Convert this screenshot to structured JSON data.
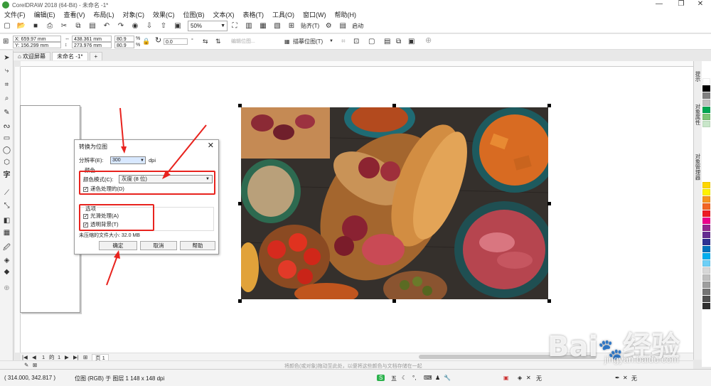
{
  "window": {
    "title": "CorelDRAW 2018 (64-Bit) - 未命名 -1*",
    "minimize": "—",
    "restore": "❐",
    "close": "✕"
  },
  "menu": [
    "文件(F)",
    "编辑(E)",
    "查看(V)",
    "布局(L)",
    "对象(C)",
    "效果(C)",
    "位图(B)",
    "文本(X)",
    "表格(T)",
    "工具(O)",
    "窗口(W)",
    "帮助(H)"
  ],
  "toolbar": {
    "zoom": "50%",
    "snap_label": "贴齐(T)",
    "launch_label": "启动"
  },
  "propbar": {
    "x": "X: 659.97 mm",
    "y": "Y: 156.299 mm",
    "width": "438.361 mm",
    "height": "273.976 mm",
    "scale_x": "80.9",
    "scale_y": "80.9",
    "pct": "%",
    "rotation": "0.0",
    "degree": "°",
    "edit_bitmap": "编辑位图...",
    "trace_bitmap": "描摹位图(T)"
  },
  "tabs": [
    "欢迎屏幕",
    "未命名 -1*"
  ],
  "dialog": {
    "title": "转换为位图",
    "resolution_label": "分辨率(E):",
    "resolution_value": "300",
    "dpi": "dpi",
    "color_section": "颜色",
    "color_mode_label": "颜色模式(C):",
    "color_mode_value": "灰度 (8 位)",
    "dithered_label": "递色处理的(D)",
    "options_section": "选项",
    "antialiasing_label": "光滑处理(A)",
    "transparent_label": "透明背景(T)",
    "uncompressed_size": "未压缩的文件大小: 32.0 MB",
    "ok": "确定",
    "cancel": "取消",
    "help": "帮助"
  },
  "docker_tabs": [
    "提示",
    "对象属性",
    "对象管理器"
  ],
  "page_nav": {
    "page_current": "1",
    "of": "的",
    "page_total": "1",
    "page_tab": "页 1"
  },
  "hint": "将颜色(或对象)拖动至此处，以便将这些颜色与文档存储在一起",
  "status": {
    "coords": "( 314.000, 342.817 )",
    "object_info": "位图 (RGB) 于 图层 1 148 x 148 dpi",
    "fill_none": "无",
    "outline_none": "无",
    "ime": "五"
  },
  "watermark": {
    "brand": "Bai 经验",
    "url": "jingyan.baidu.com"
  },
  "colors": {
    "red_annotation": "#e8231e",
    "palette": [
      "#ffffff",
      "#000000",
      "#808080",
      "#c0c0c0",
      "#00a651",
      "#7cc576",
      "#c8e6c9",
      "#ffd600",
      "#fff200",
      "#f7941d",
      "#f26522",
      "#ed1c24",
      "#ec008c",
      "#92278f",
      "#662d91",
      "#2e3192",
      "#0072bc",
      "#00aeef",
      "#6dcff6",
      "#d7d7d7",
      "#bfbfbf",
      "#9e9e9e",
      "#757575",
      "#505050",
      "#303030"
    ]
  }
}
